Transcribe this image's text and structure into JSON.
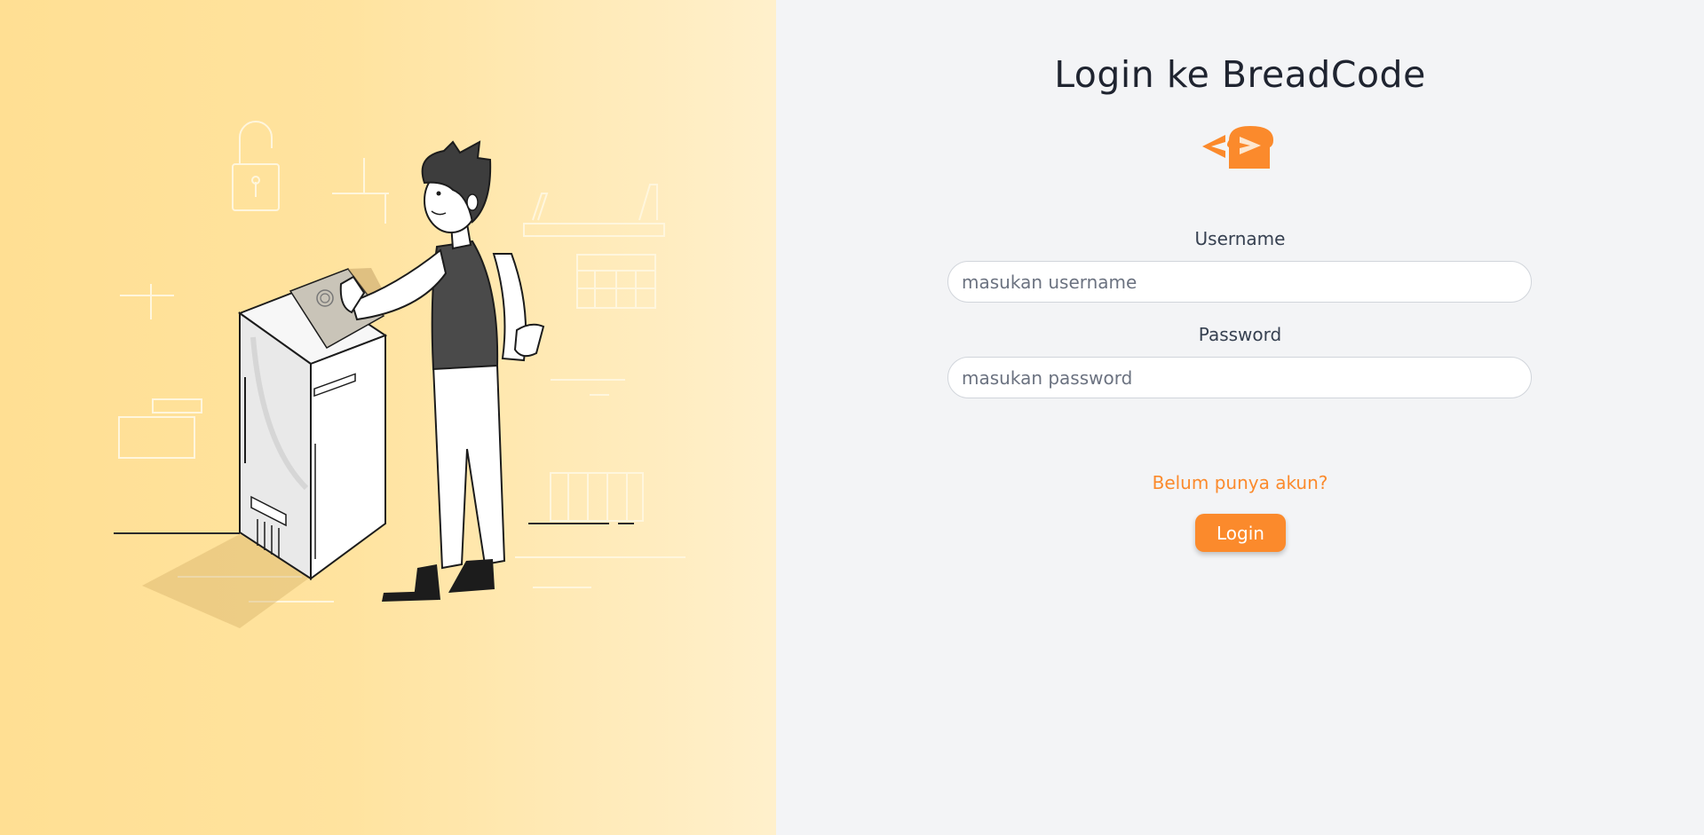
{
  "page": {
    "title": "Login ke BreadCode",
    "logo_icon": "breadcode-logo-icon",
    "illustration": "fingerprint-scanner-illustration"
  },
  "form": {
    "username": {
      "label": "Username",
      "placeholder": "masukan username",
      "value": ""
    },
    "password": {
      "label": "Password",
      "placeholder": "masukan password",
      "value": ""
    },
    "register_link": "Belum punya akun?",
    "login_button": "Login"
  },
  "colors": {
    "accent": "#fb8a2c",
    "left_bg_start": "#ffdf93",
    "left_bg_end": "#fff0cc",
    "right_bg": "#f3f4f6"
  }
}
